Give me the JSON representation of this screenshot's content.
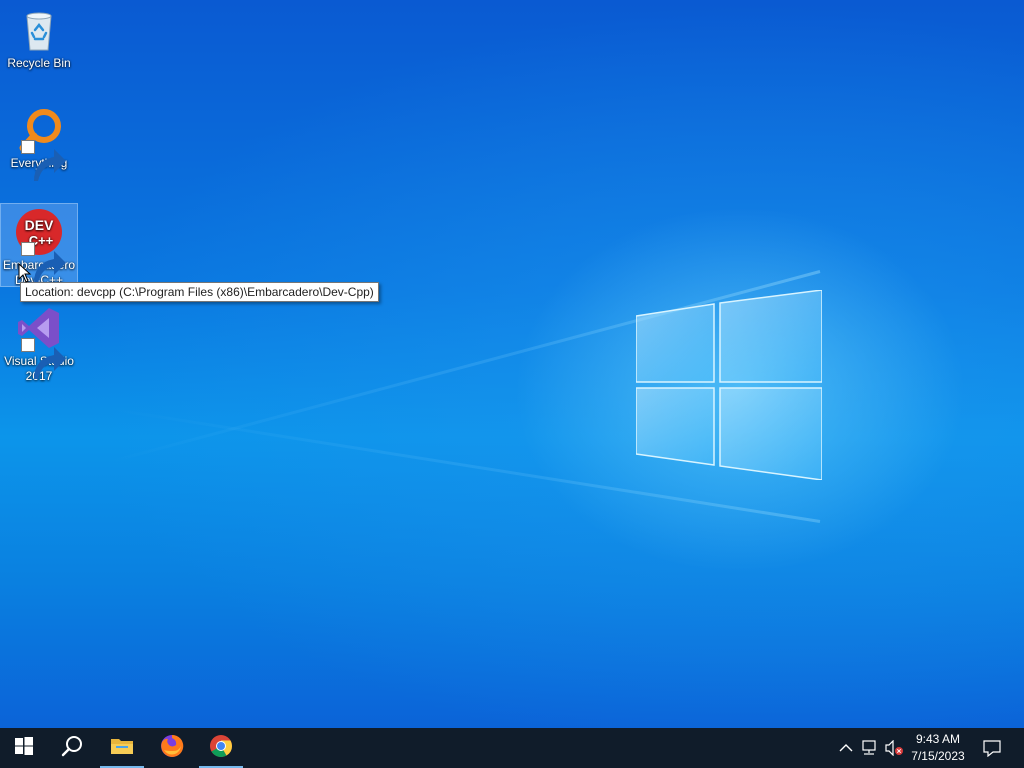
{
  "desktop": {
    "icons": [
      {
        "label": "Recycle Bin",
        "icon": "recycle-bin-icon"
      },
      {
        "label": "Everything",
        "icon": "everything-search-icon"
      },
      {
        "label": "Embarcadero Dev-C++",
        "icon": "devcpp-icon",
        "icon_text_top": "DEV",
        "icon_text_bottom": "C++",
        "selected": true
      },
      {
        "label": "Visual Studio 2017",
        "icon": "visual-studio-icon"
      }
    ],
    "tooltip": "Location: devcpp (C:\\Program Files (x86)\\Embarcadero\\Dev-Cpp)"
  },
  "taskbar": {
    "pinned": [
      {
        "name": "start-button",
        "icon": "windows-start-icon"
      },
      {
        "name": "search-button",
        "icon": "search-icon"
      },
      {
        "name": "file-explorer",
        "icon": "folder-icon",
        "running": true
      },
      {
        "name": "firefox",
        "icon": "firefox-icon"
      },
      {
        "name": "chrome",
        "icon": "chrome-icon",
        "running": true
      }
    ],
    "tray": {
      "icons": [
        "chevron-up-icon",
        "network-icon",
        "volume-muted-icon"
      ],
      "time": "9:43 AM",
      "date": "7/15/2023"
    }
  },
  "colors": {
    "taskbar_bg": "#101c2a",
    "accent": "#76b9ed",
    "wallpaper_blue": "#0a78e0"
  }
}
